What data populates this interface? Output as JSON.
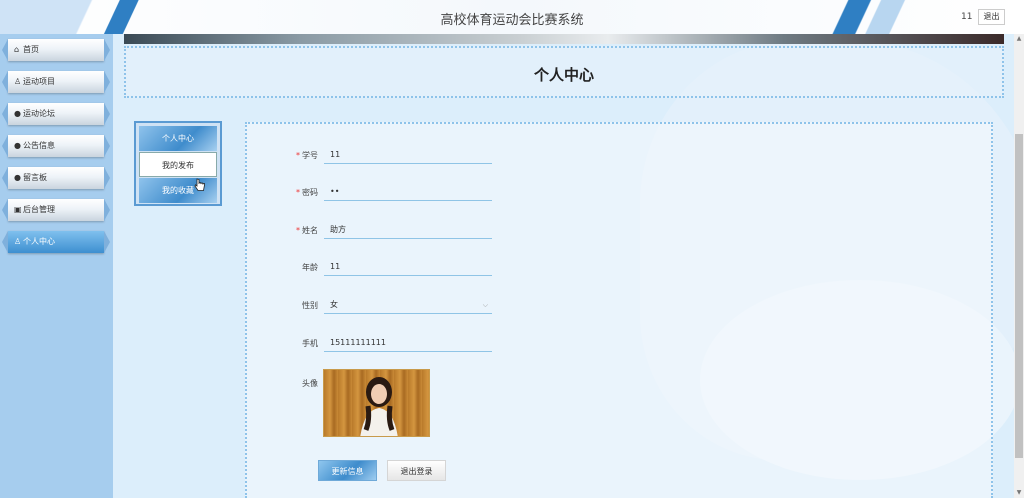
{
  "header": {
    "title": "高校体育运动会比赛系统",
    "username": "11",
    "logout_label": "退出"
  },
  "sidebar": {
    "items": [
      {
        "label": "首页",
        "icon": "home-icon",
        "glyph": "⌂",
        "active": false
      },
      {
        "label": "运动项目",
        "icon": "trophy-icon",
        "glyph": "♙",
        "active": false
      },
      {
        "label": "运动论坛",
        "icon": "forum-icon",
        "glyph": "●",
        "active": false
      },
      {
        "label": "公告信息",
        "icon": "notice-icon",
        "glyph": "●",
        "active": false
      },
      {
        "label": "留言板",
        "icon": "message-icon",
        "glyph": "●",
        "active": false
      },
      {
        "label": "后台管理",
        "icon": "admin-icon",
        "glyph": "▣",
        "active": false
      },
      {
        "label": "个人中心",
        "icon": "user-icon",
        "glyph": "♙",
        "active": true
      }
    ]
  },
  "page": {
    "title": "个人中心"
  },
  "submenu": {
    "items": [
      {
        "label": "个人中心"
      },
      {
        "label": "我的发布"
      },
      {
        "label": "我的收藏"
      }
    ]
  },
  "form": {
    "fields": [
      {
        "label": "学号",
        "value": "11",
        "required": true
      },
      {
        "label": "密码",
        "value": "••",
        "required": true
      },
      {
        "label": "姓名",
        "value": "助方",
        "required": true
      },
      {
        "label": "年龄",
        "value": "11",
        "required": false
      },
      {
        "label": "性别",
        "value": "女",
        "required": false,
        "select": true
      },
      {
        "label": "手机",
        "value": "15111111111",
        "required": false
      }
    ],
    "avatar_label": "头像",
    "update_button": "更新信息",
    "logout_button": "退出登录"
  },
  "colors": {
    "accent": "#3d8fd0",
    "required": "#e33333"
  }
}
